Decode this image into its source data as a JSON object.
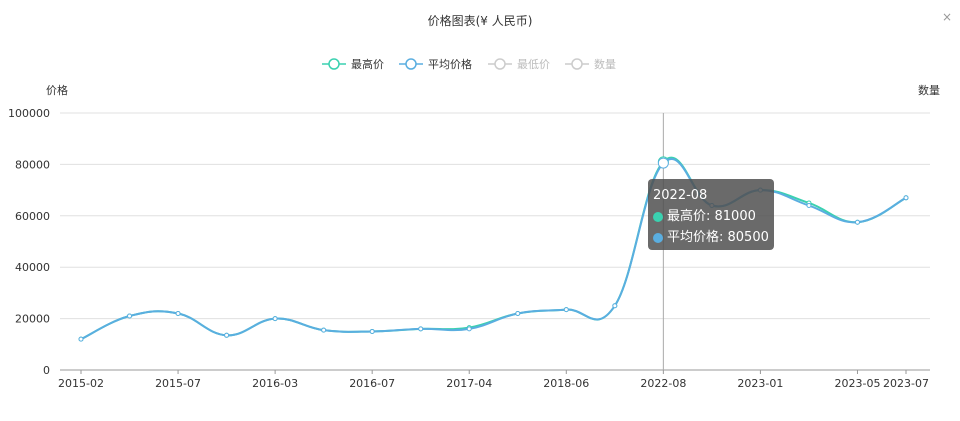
{
  "title": "价格图表(¥ 人民币)",
  "close_icon": "×",
  "legend": [
    {
      "label": "最高价",
      "color": "#3ad1b0",
      "active": true
    },
    {
      "label": "平均价格",
      "color": "#5aaee0",
      "active": true
    },
    {
      "label": "最低价",
      "color": "#cccccc",
      "active": false
    },
    {
      "label": "数量",
      "color": "#cccccc",
      "active": false
    }
  ],
  "axis": {
    "y_name": "价格",
    "y2_name": "数量"
  },
  "tooltip": {
    "date": "2022-08",
    "rows": [
      {
        "label": "最高价: 81000",
        "color": "#3ad1b0"
      },
      {
        "label": "平均价格: 80500",
        "color": "#5aaee0"
      }
    ]
  },
  "chart_data": {
    "type": "line",
    "title": "价格图表(¥ 人民币)",
    "ylabel": "价格",
    "y2label": "数量",
    "ylim": [
      0,
      100000
    ],
    "yticks": [
      0,
      20000,
      40000,
      60000,
      80000,
      100000
    ],
    "x_tick_labels": [
      "2015-02",
      "2015-07",
      "2016-03",
      "2016-07",
      "2017-04",
      "2018-06",
      "2022-08",
      "2023-01",
      "2023-05",
      "2023-07"
    ],
    "grid": true,
    "legend_position": "top-center",
    "highlight_x": "2022-08",
    "series": [
      {
        "name": "最高价",
        "color": "#3ad1b0",
        "values": [
          12000,
          21000,
          22000,
          13500,
          20000,
          15500,
          15000,
          16000,
          16500,
          22000,
          23500,
          25000,
          81000,
          64000,
          70000,
          65000,
          57500,
          67000
        ]
      },
      {
        "name": "平均价格",
        "color": "#5aaee0",
        "values": [
          12000,
          21000,
          22000,
          13500,
          20000,
          15500,
          15000,
          16000,
          16000,
          22000,
          23500,
          25000,
          80500,
          64000,
          70000,
          64000,
          57500,
          67000
        ]
      }
    ]
  }
}
